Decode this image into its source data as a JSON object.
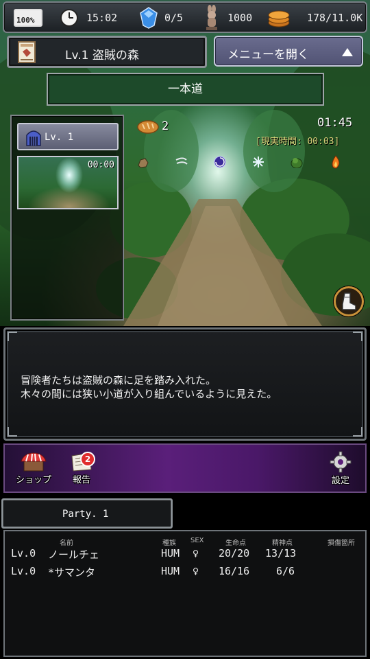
{
  "status_bar": {
    "battery": "100%",
    "time": "15:02",
    "gems": "0/5",
    "rabbit_count": "1000",
    "coins": "178/11.0K"
  },
  "location": {
    "title": "Lv.1 盗賊の森"
  },
  "menu_button": {
    "label": "メニューを開く"
  },
  "route": {
    "name": "一本道"
  },
  "floor": {
    "label": "Lv. 1",
    "thumb_time": "00:00"
  },
  "scene": {
    "bread_count": "2",
    "elapsed": "01:45",
    "real_time": "[現実時間: 00:03]",
    "icons": [
      "rock-icon",
      "wind-icon",
      "vortex-icon",
      "snowflake-icon",
      "bush-icon",
      "fire-icon"
    ]
  },
  "message": {
    "lines": [
      "冒険者たちは盗賊の森に足を踏み入れた。",
      "木々の間には狭い小道が入り組んでいるように見えた。"
    ]
  },
  "actions": {
    "shop": "ショップ",
    "report": "報告",
    "report_badge": "2",
    "settings": "設定"
  },
  "party": {
    "tab_label": "Party. 1",
    "headers": {
      "name": "名前",
      "race": "種族",
      "sex": "SEX",
      "hp": "生命点",
      "mp": "精神点",
      "injury": "損傷箇所"
    },
    "members": [
      {
        "level": "Lv.0",
        "name": "ノールチェ",
        "race": "HUM",
        "sex": "♀",
        "hp": "20/20",
        "mp": "13/13"
      },
      {
        "level": "Lv.0",
        "name": "*サマンタ",
        "race": "HUM",
        "sex": "♀",
        "hp": "16/16",
        "mp": "6/6"
      }
    ]
  }
}
